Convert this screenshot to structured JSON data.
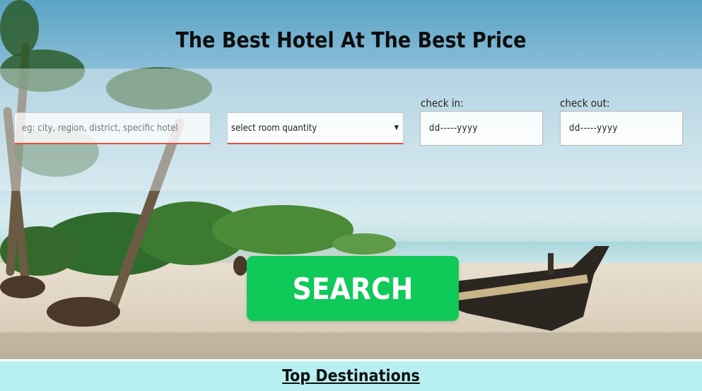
{
  "header": {
    "title": "The Best Hotel At The Best Price"
  },
  "search_form": {
    "destination": {
      "placeholder": "eg: city, region, district, specific hotel"
    },
    "rooms": {
      "selected": "select room quantity",
      "caret": "▼"
    },
    "check_in": {
      "label": "check in:",
      "value": "dd-----yyyy"
    },
    "check_out": {
      "label": "check out:",
      "value": "dd-----yyyy"
    },
    "search_label": "SEARCH"
  },
  "footer": {
    "heading": "Top Destinations"
  },
  "colors": {
    "accent": "#0fca58",
    "input_underline": "#e0523e",
    "footer_bg": "#b8f0f2"
  }
}
